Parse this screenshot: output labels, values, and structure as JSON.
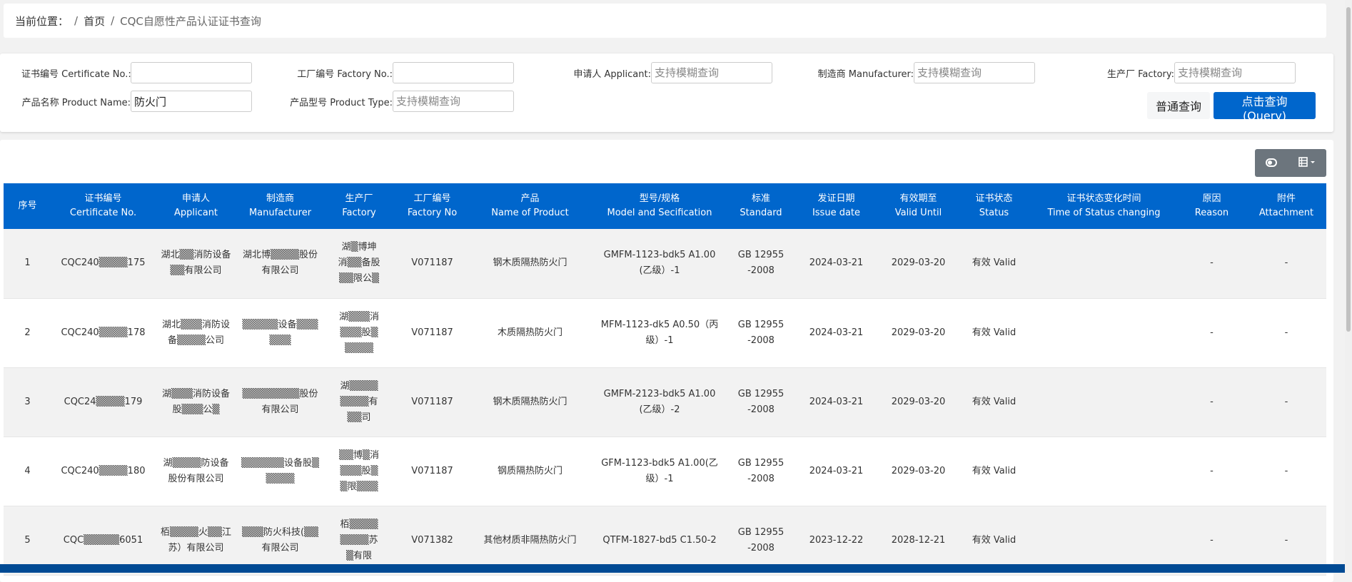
{
  "breadcrumb": {
    "label": "当前位置：",
    "home": "首页",
    "current": "CQC自愿性产品认证证书查询"
  },
  "search": {
    "fields": [
      {
        "label": "证书编号 Certificate No.:",
        "value": "",
        "placeholder": ""
      },
      {
        "label": "工厂编号 Factory No.:",
        "value": "",
        "placeholder": ""
      },
      {
        "label": "申请人 Applicant:",
        "value": "",
        "placeholder": "支持模糊查询"
      },
      {
        "label": "制造商 Manufacturer:",
        "value": "",
        "placeholder": "支持模糊查询"
      },
      {
        "label": "生产厂 Factory:",
        "value": "",
        "placeholder": "支持模糊查询"
      },
      {
        "label": "产品名称 Product Name:",
        "value": "防火门",
        "placeholder": ""
      },
      {
        "label": "产品型号 Product Type:",
        "value": "",
        "placeholder": "支持模糊查询"
      }
    ],
    "plain_button": "普通查询",
    "query_button": "点击查询(Query)"
  },
  "toolbar": {
    "icons": [
      "toggle-icon",
      "columns-icon"
    ]
  },
  "table": {
    "headers": [
      [
        "序号",
        ""
      ],
      [
        "证书编号",
        "Certificate No."
      ],
      [
        "申请人",
        "Applicant"
      ],
      [
        "制造商",
        "Manufacturer"
      ],
      [
        "生产厂",
        "Factory"
      ],
      [
        "工厂编号",
        "Factory No"
      ],
      [
        "产品",
        "Name of Product"
      ],
      [
        "型号/规格",
        "Model and Secification"
      ],
      [
        "标准",
        "Standard"
      ],
      [
        "发证日期",
        "Issue date"
      ],
      [
        "有效期至",
        "Valid Until"
      ],
      [
        "证书状态",
        "Status"
      ],
      [
        "证书状态变化时间",
        "Time of Status changing"
      ],
      [
        "原因",
        "Reason"
      ],
      [
        "附件",
        "Attachment"
      ]
    ],
    "rows": [
      [
        "1",
        "CQC240▒▒▒▒175",
        "湖北▒▒消防设备▒▒有限公司",
        "湖北博▒▒▒▒股份有限公司",
        "湖▒博坤消▒▒备股▒▒限公▒",
        "V071187",
        "钢木质隔热防火门",
        "GMFM-1123-bdk5 A1.00(乙级）-1",
        "GB 12955-2008",
        "2024-03-21",
        "2029-03-20",
        "有效 Valid",
        "",
        "-",
        "-"
      ],
      [
        "2",
        "CQC240▒▒▒▒178",
        "湖北▒▒▒消防设备▒▒▒▒公司",
        "▒▒▒▒▒设备▒▒▒▒▒▒",
        "湖▒▒▒消▒▒▒股▒▒▒▒▒",
        "V071187",
        "木质隔热防火门",
        "MFM-1123-dk5 A0.50（丙级）-1",
        "GB 12955-2008",
        "2024-03-21",
        "2029-03-20",
        "有效 Valid",
        "",
        "-",
        "-"
      ],
      [
        "3",
        "CQC24▒▒▒▒179",
        "湖▒▒▒消防设备股▒▒▒公▒",
        "▒▒▒▒▒▒▒▒股份有限公司",
        "湖▒▒▒▒▒▒▒▒有▒▒司",
        "V071187",
        "钢木质隔热防火门",
        "GMFM-2123-bdk5 A1.00(乙级）-2",
        "GB 12955-2008",
        "2024-03-21",
        "2029-03-20",
        "有效 Valid",
        "",
        "-",
        "-"
      ],
      [
        "4",
        "CQC240▒▒▒▒180",
        "湖▒▒▒▒防设备股份有限公司",
        "▒▒▒▒▒▒设备股▒▒▒▒▒",
        "▒▒博▒消▒▒▒股▒▒限▒▒▒",
        "V071187",
        "钢质隔热防火门",
        "GFM-1123-bdk5 A1.00(乙级）-1",
        "GB 12955-2008",
        "2024-03-21",
        "2029-03-20",
        "有效 Valid",
        "",
        "-",
        "-"
      ],
      [
        "5",
        "CQC▒▒▒▒▒6051",
        "栢▒▒▒▒火▒▒江苏）有限公司",
        "▒▒▒防火科技(▒▒有限公司",
        "栢▒▒▒▒▒▒▒▒苏▒有限",
        "V071382",
        "其他材质非隔热防火门",
        "QTFM-1827-bd5 C1.50-2",
        "GB 12955-2008",
        "2023-12-22",
        "2028-12-21",
        "有效 Valid",
        "",
        "-",
        "-"
      ]
    ]
  },
  "colors": {
    "header_bg": "#0066cc",
    "query_button": "#0066cc",
    "footer": "#004a94",
    "toolbar_button": "#6c757d"
  }
}
